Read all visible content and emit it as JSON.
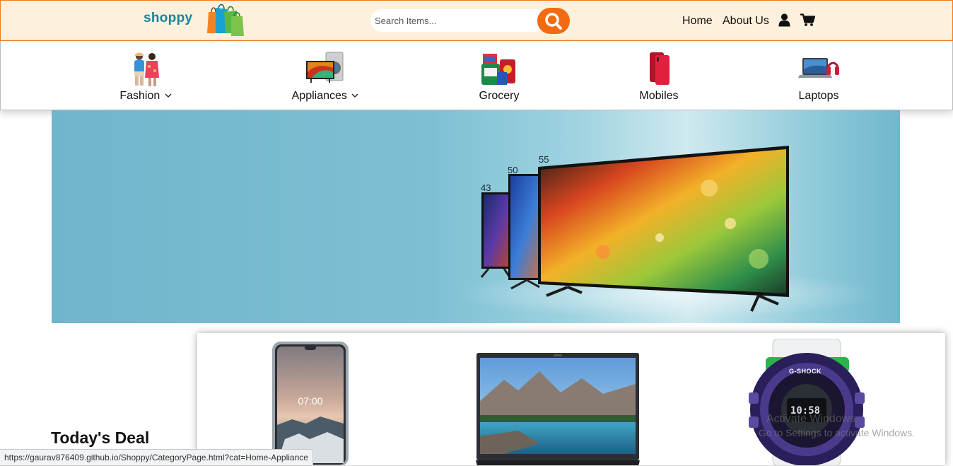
{
  "header": {
    "logo_text": "shoppy",
    "search_placeholder": "Search Items...",
    "nav": {
      "home": "Home",
      "about": "About Us"
    },
    "colors": {
      "header_bg": "#fdf0dc",
      "accent": "#f36a12",
      "logo": "#14869a"
    }
  },
  "categories": [
    {
      "label": "Fashion",
      "has_dropdown": true,
      "icon": "fashion-couple-image"
    },
    {
      "label": "Appliances",
      "has_dropdown": true,
      "icon": "washing-machine-tv-image"
    },
    {
      "label": "Grocery",
      "has_dropdown": false,
      "icon": "grocery-packs-image"
    },
    {
      "label": "Mobiles",
      "has_dropdown": false,
      "icon": "red-phone-image"
    },
    {
      "label": "Laptops",
      "has_dropdown": false,
      "icon": "laptop-headphone-image"
    }
  ],
  "banner": {
    "tv_sizes": [
      "43",
      "50",
      "55"
    ]
  },
  "deals": {
    "title": "Today's Deal",
    "items": [
      {
        "image": "smartphone-image",
        "screen_time": "07:00"
      },
      {
        "image": "laptop-image"
      },
      {
        "image": "g-shock-watch-image",
        "brand": "G-SHOCK",
        "watch_time": "10:58"
      }
    ]
  },
  "status_url": "https://gaurav876409.github.io/Shoppy/CategoryPage.html?cat=Home-Appliance",
  "watermark": {
    "line1": "Activate Windows",
    "line2": "Go to Settings to activate Windows."
  }
}
